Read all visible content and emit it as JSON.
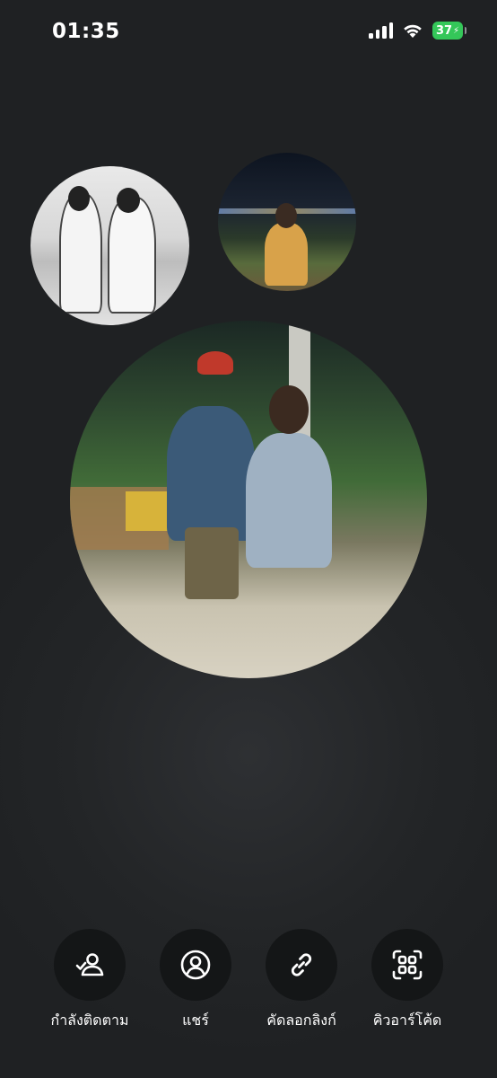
{
  "status_bar": {
    "time": "01:35",
    "battery_level": "37"
  },
  "photos": [
    {
      "name": "profile-photo-bw",
      "tone": "#d7d7d7"
    },
    {
      "name": "profile-photo-night",
      "tone": "#1c2431"
    },
    {
      "name": "profile-photo-main",
      "tone": "#416b38"
    }
  ],
  "actions": [
    {
      "label": "กำลังติดตาม",
      "icon": "following-check-user-icon"
    },
    {
      "label": "แชร์",
      "icon": "user-circle-icon"
    },
    {
      "label": "คัดลอกลิงก์",
      "icon": "link-icon"
    },
    {
      "label": "คิวอาร์โค้ด",
      "icon": "qr-code-scan-icon"
    }
  ]
}
